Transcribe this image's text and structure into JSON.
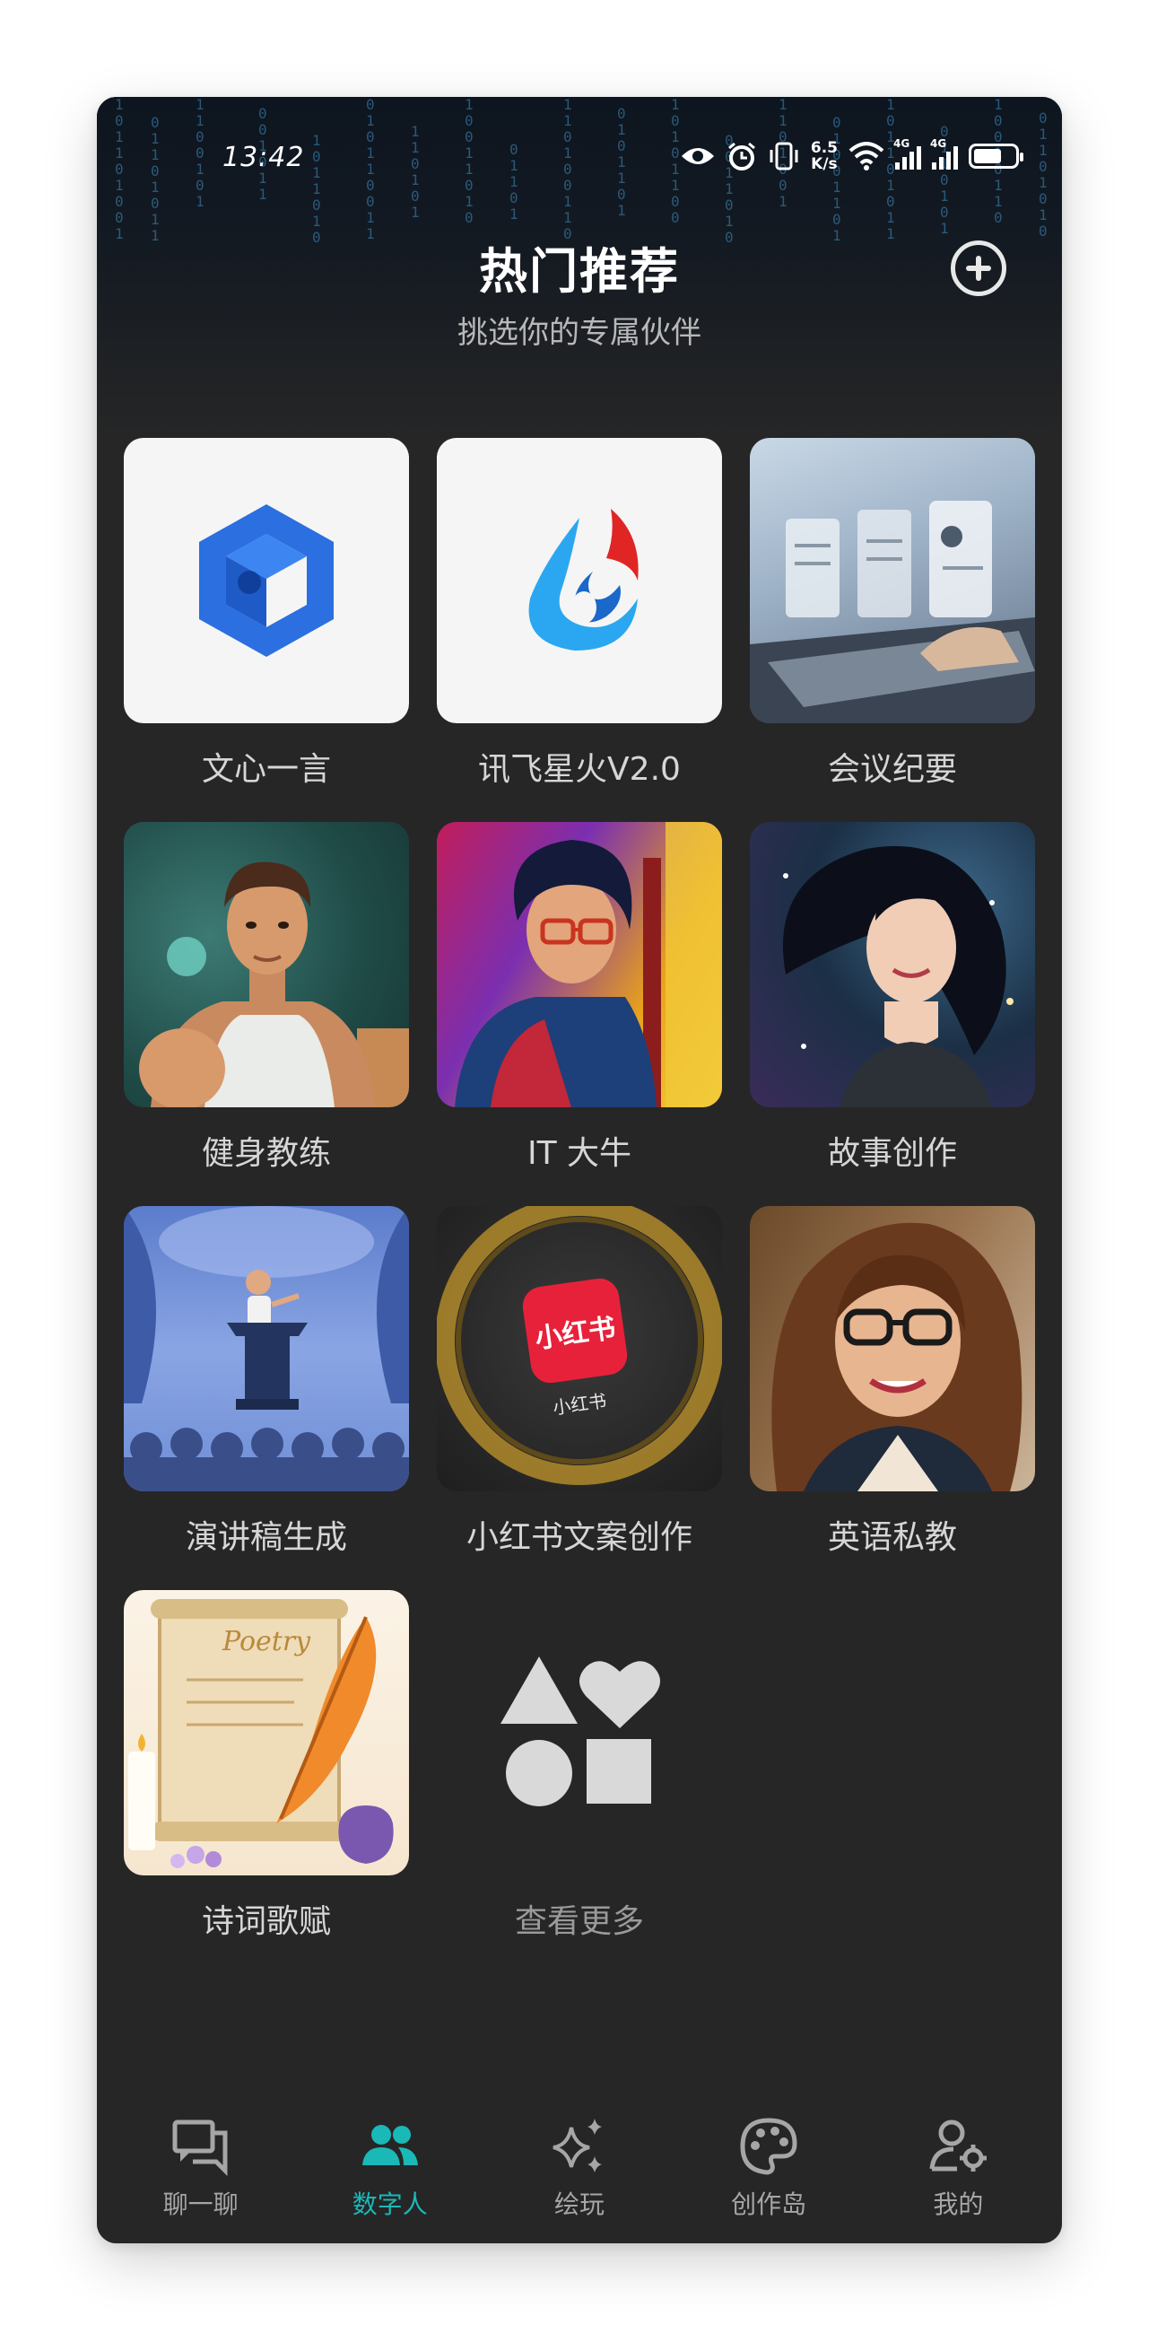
{
  "status_bar": {
    "time": "13:42",
    "net_speed_value": "6.5",
    "net_speed_unit": "K/s",
    "signal_1": "4G",
    "signal_2": "4G"
  },
  "header": {
    "title": "热门推荐",
    "subtitle": "挑选你的专属伙伴"
  },
  "cards": [
    {
      "label": "文心一言",
      "icon": "wenxin-logo-icon"
    },
    {
      "label": "讯飞星火V2.0",
      "icon": "xunfei-spark-logo-icon"
    },
    {
      "label": "会议纪要",
      "icon": "meeting-laptop-image"
    },
    {
      "label": "健身教练",
      "icon": "fitness-coach-image"
    },
    {
      "label": "IT 大牛",
      "icon": "it-expert-image"
    },
    {
      "label": "故事创作",
      "icon": "story-girl-image"
    },
    {
      "label": "演讲稿生成",
      "icon": "speech-podium-image"
    },
    {
      "label": "小红书文案创作",
      "icon": "xiaohongshu-image"
    },
    {
      "label": "英语私教",
      "icon": "english-tutor-image"
    },
    {
      "label": "诗词歌赋",
      "icon": "poetry-scroll-image"
    }
  ],
  "xiaohongshu_badge": "小红书",
  "xiaohongshu_caption": "小红书",
  "poetry_scroll_text": "Poetry",
  "more": {
    "label": "查看更多",
    "icon": "shapes-icon"
  },
  "nav": [
    {
      "label": "聊一聊",
      "icon": "chat-icon",
      "active": false
    },
    {
      "label": "数字人",
      "icon": "people-icon",
      "active": true
    },
    {
      "label": "绘玩",
      "icon": "sparkle-icon",
      "active": false
    },
    {
      "label": "创作岛",
      "icon": "palette-icon",
      "active": false
    },
    {
      "label": "我的",
      "icon": "user-settings-icon",
      "active": false
    }
  ],
  "colors": {
    "background": "#262626",
    "accent": "#1bb8b8",
    "text_primary": "#ffffff",
    "text_secondary": "#d6d6d6"
  }
}
